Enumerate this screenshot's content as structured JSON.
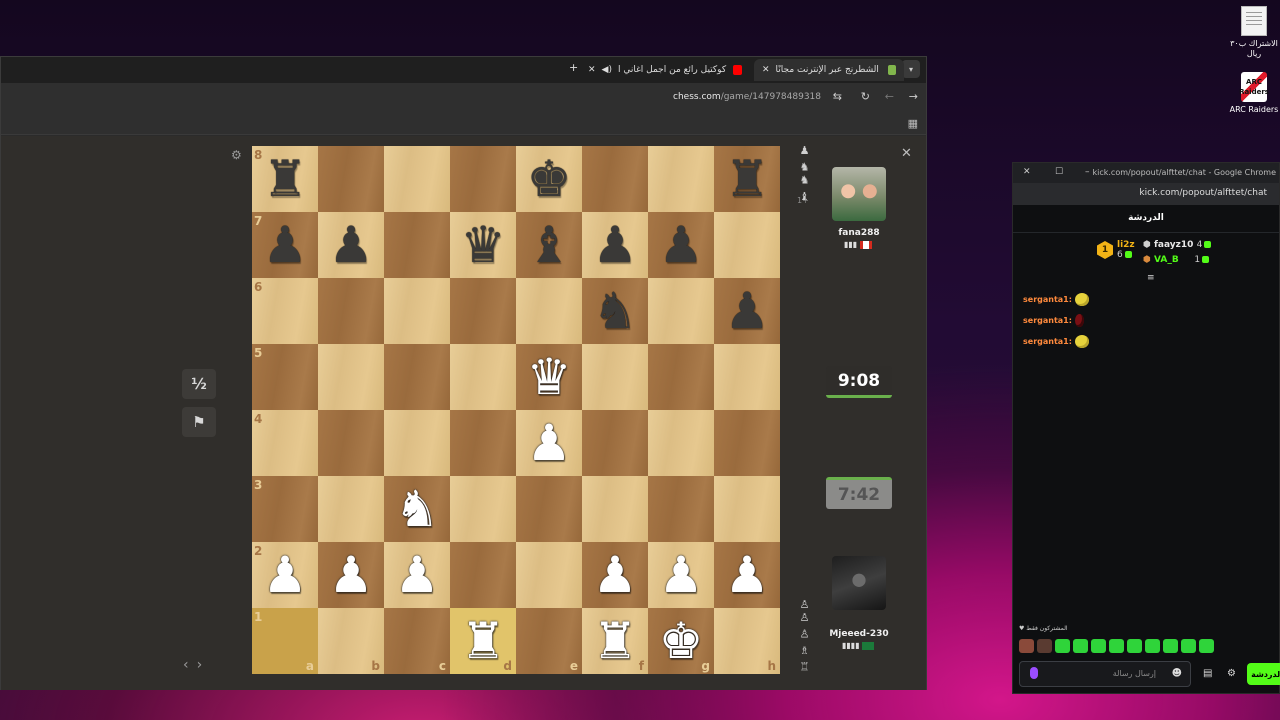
{
  "desktop": {
    "icons": [
      {
        "label": "الاشتراك ب٣٠ ريال"
      },
      {
        "label": "ARC Raiders",
        "logo_text": "ARC Raiders"
      }
    ]
  },
  "browser": {
    "tabs": [
      {
        "title": "العب الشطرنج عبر الإنترنت مجانًا",
        "active": true,
        "icon": "pawn-icon",
        "color": "#81b64c"
      },
      {
        "title": "كوكتيل رائع من اجمل اغاني أ...",
        "active": false,
        "icon": "youtube-icon",
        "color": "#ff0000"
      }
    ],
    "url_host": "chess.com",
    "url_path": "/game/147978489318"
  },
  "game": {
    "files": [
      "a",
      "b",
      "c",
      "d",
      "e",
      "f",
      "g",
      "h"
    ],
    "ranks": [
      "8",
      "7",
      "6",
      "5",
      "4",
      "3",
      "2",
      "1"
    ],
    "board": [
      [
        "bR",
        "",
        "",
        "",
        "bK",
        "",
        "",
        "bR"
      ],
      [
        "bP",
        "bP",
        "",
        "bQ",
        "bB",
        "bP",
        "bP",
        ""
      ],
      [
        "",
        "",
        "",
        "",
        "",
        "bN",
        "",
        "bP"
      ],
      [
        "",
        "",
        "",
        "",
        "wQ",
        "",
        "",
        ""
      ],
      [
        "",
        "",
        "",
        "",
        "wP",
        "",
        "",
        ""
      ],
      [
        "",
        "",
        "wN",
        "",
        "",
        "",
        "",
        ""
      ],
      [
        "wP",
        "wP",
        "wP",
        "",
        "",
        "wP",
        "wP",
        "wP"
      ],
      [
        "",
        "",
        "",
        "wR",
        "",
        "wR",
        "wK",
        ""
      ]
    ],
    "highlight_squares": [
      "a1",
      "d1"
    ],
    "draw_label": "½",
    "top_player": {
      "name": "fana288",
      "country": "Canada",
      "captured": "♟ ♞♞ ♝",
      "advantage": "1+"
    },
    "bottom_player": {
      "name": "Mjeeed-230",
      "captured": "♙♙ ♙ ♗ ♖"
    },
    "top_clock": "9:08",
    "bottom_clock": "7:42"
  },
  "chat": {
    "window_title": "kick.com/popout/alfttet/chat - Google Chrome",
    "url": "kick.com/popout/alfttet/chat",
    "header": "الدردشة",
    "leaders": [
      {
        "name": "li2z",
        "count": "6"
      },
      {
        "name": "faayz10",
        "count": "4"
      },
      {
        "name": "VA_B",
        "count": "1"
      }
    ],
    "messages": [
      {
        "user": "serganta1:"
      },
      {
        "user": "serganta1:"
      },
      {
        "user": "serganta1:"
      }
    ],
    "subs_label": "المشتركون فقط",
    "input_placeholder": "إرسال رسالة",
    "send_label": "الدردشة",
    "accent": "#53fc18"
  }
}
